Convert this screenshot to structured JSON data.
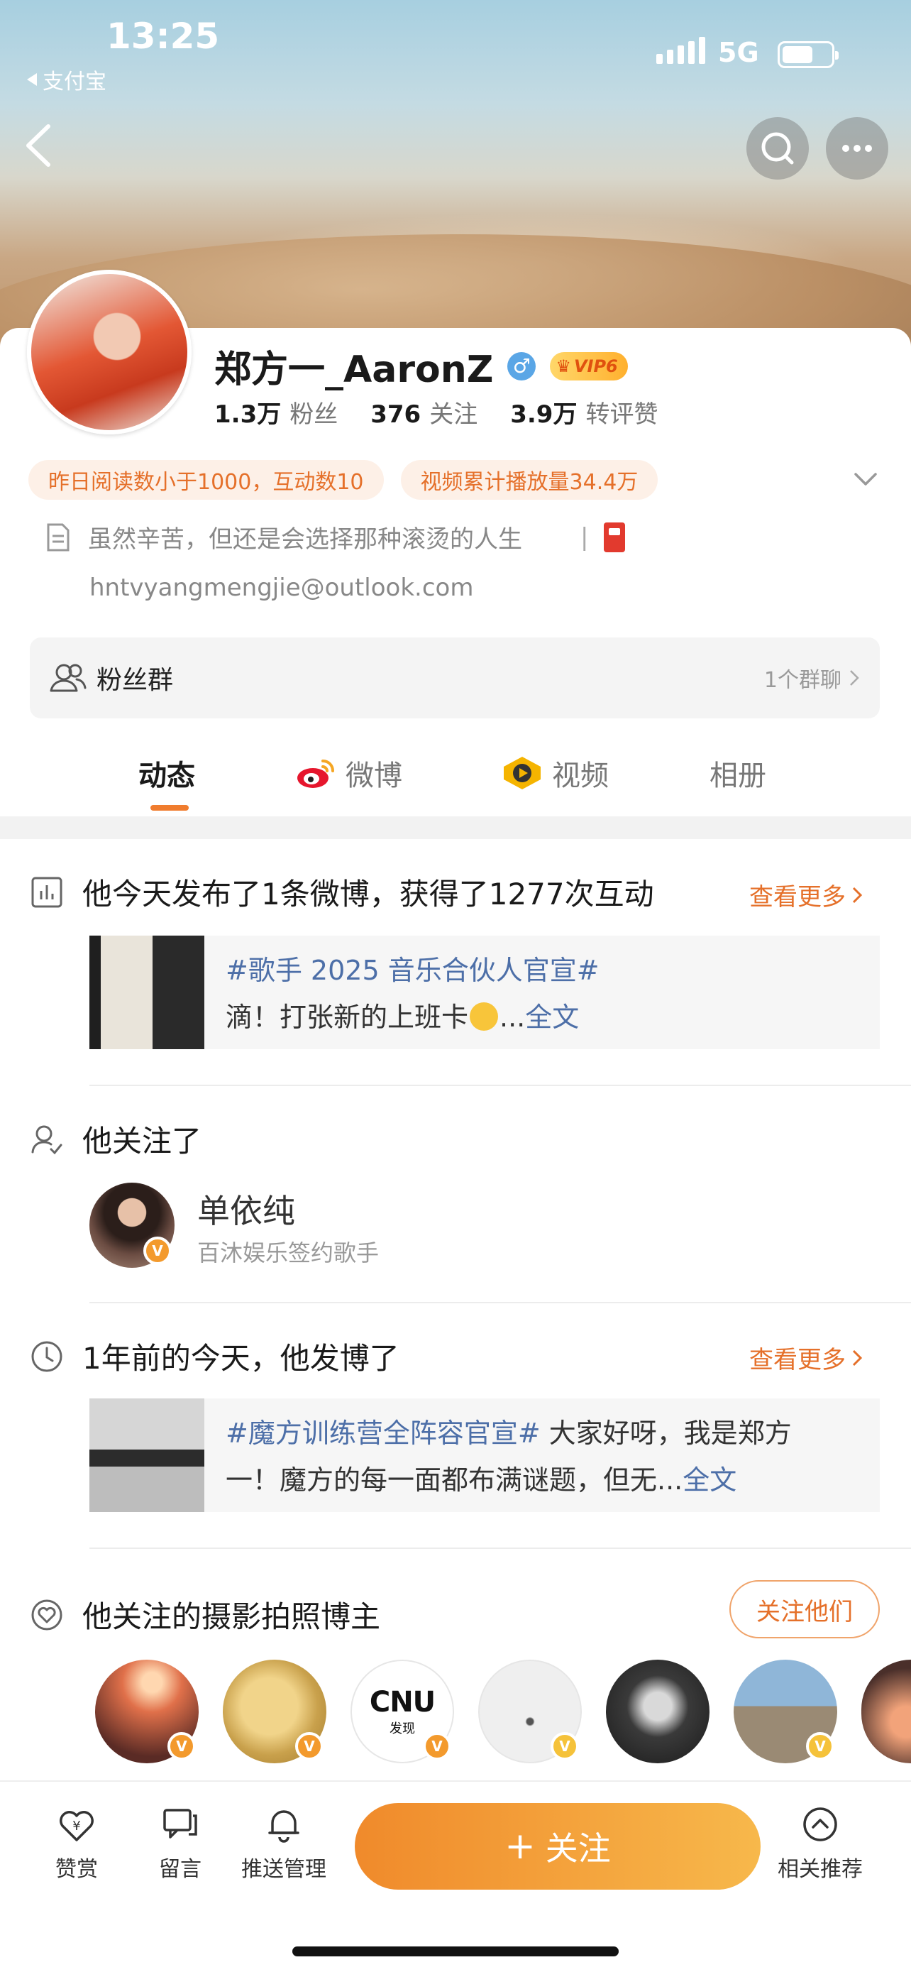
{
  "status_bar": {
    "time": "13:25",
    "back_app": "支付宝",
    "network": "5G",
    "battery_level": 0.55
  },
  "profile": {
    "name": "郑方一_AaronZ",
    "gender_icon": "male",
    "vip": "VIP6",
    "stats": [
      {
        "value": "1.3万",
        "label": "粉丝"
      },
      {
        "value": "376",
        "label": "关注"
      },
      {
        "value": "3.9万",
        "label": "转评赞"
      }
    ],
    "tags": [
      "昨日阅读数小于1000，互动数10",
      "视频累计播放量34.4万"
    ],
    "bio": "虽然辛苦，但还是会选择那种滚烫的人生",
    "bio_sep": "|",
    "email": "hntvyangmengjie@outlook.com"
  },
  "fans_group": {
    "label": "粉丝群",
    "count": "1个群聊"
  },
  "tabs": [
    {
      "label": "动态",
      "active": true
    },
    {
      "label": "微博",
      "active": false
    },
    {
      "label": "视频",
      "active": false
    },
    {
      "label": "相册",
      "active": false
    }
  ],
  "feed": {
    "today": {
      "title": "他今天发布了1条微博，获得了1277次互动",
      "more": "查看更多",
      "post_hashtag": "#歌手 2025 音乐合伙人官宣#",
      "post_text": "滴！打张新的上班卡",
      "post_ellipsis": "...",
      "post_full": "全文"
    },
    "following": {
      "title": "他关注了",
      "name": "单依纯",
      "desc": "百沐娱乐签约歌手",
      "badge": "V"
    },
    "year_ago": {
      "title": "1年前的今天，他发博了",
      "more": "查看更多",
      "post_hashtag": "#魔方训练营全阵容官宣#",
      "post_text_1": " 大家好呀，我是郑方",
      "post_text_2": "一！魔方的每一面都布满谜题，但无...",
      "post_full": "全文"
    },
    "photographers": {
      "title": "他关注的摄影拍照博主",
      "follow_button": "关注他们",
      "cnu_text": "CNU",
      "cnu_sub": "发现",
      "badge": "V"
    }
  },
  "bottom_bar": {
    "reward": "赞赏",
    "message": "留言",
    "push": "推送管理",
    "follow": "关注",
    "follow_plus": "+",
    "related": "相关推荐"
  },
  "colors": {
    "accent": "#e5702a",
    "link": "#4d6fa8",
    "follow_gradient_start": "#f08a2b",
    "follow_gradient_end": "#f7b84b"
  }
}
